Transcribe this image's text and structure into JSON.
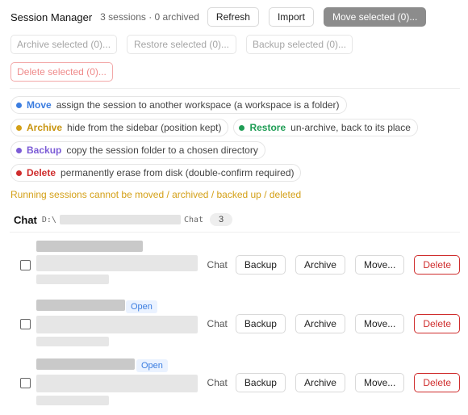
{
  "header": {
    "title": "Session Manager",
    "counts": "3 sessions · 0 archived",
    "refresh": "Refresh",
    "import": "Import",
    "move_selected": "Move selected (0)..."
  },
  "bulk": {
    "archive_selected": "Archive selected (0)...",
    "restore_selected": "Restore selected (0)...",
    "backup_selected": "Backup selected (0)...",
    "delete_selected": "Delete selected (0)..."
  },
  "legend": {
    "move": {
      "keyword": "Move",
      "text": "assign the session to another workspace (a workspace is a folder)",
      "color": "#3b7de0"
    },
    "archive": {
      "keyword": "Archive",
      "text": "hide from the sidebar (position kept)",
      "color": "#d4a017"
    },
    "restore": {
      "keyword": "Restore",
      "text": "un-archive, back to its place",
      "color": "#1f9d55"
    },
    "backup": {
      "keyword": "Backup",
      "text": "copy the session folder to a chosen directory",
      "color": "#7c5cd6"
    },
    "delete": {
      "keyword": "Delete",
      "text": "permanently erase from disk (double-confirm required)",
      "color": "#cf2d2d"
    }
  },
  "warning": "Running sessions cannot be moved / archived / backed up / deleted",
  "workspace": {
    "title": "Chat",
    "path_prefix": "D:\\",
    "path_suffix": "Chat",
    "count": "3"
  },
  "sessions": [
    {
      "type": "Chat",
      "open_badge": "",
      "backup": "Backup",
      "archive": "Archive",
      "move": "Move...",
      "delete": "Delete"
    },
    {
      "type": "Chat",
      "open_badge": "Open",
      "backup": "Backup",
      "archive": "Archive",
      "move": "Move...",
      "delete": "Delete"
    },
    {
      "type": "Chat",
      "open_badge": "Open",
      "backup": "Backup",
      "archive": "Archive",
      "move": "Move...",
      "delete": "Delete"
    }
  ]
}
